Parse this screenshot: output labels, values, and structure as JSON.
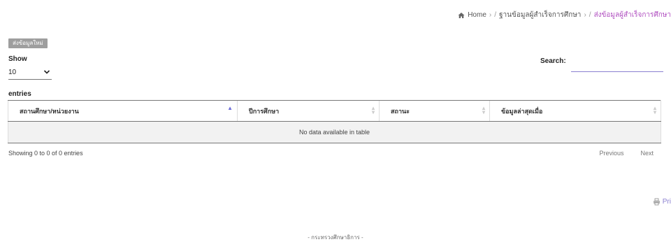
{
  "breadcrumb": {
    "home": "Home",
    "separator": "›",
    "slash": "/",
    "level1": "ฐานข้อมูลผู้สำเร็จการศึกษา",
    "current": "ส่งข้อมูลผู้สำเร็จการศึกษา"
  },
  "actions": {
    "add_label": "ส่งข้อมูลใหม่"
  },
  "length": {
    "show_label": "Show",
    "selected": "10",
    "entries_label": "entries"
  },
  "search": {
    "label": "Search:",
    "value": ""
  },
  "table": {
    "columns": [
      "สถานศึกษา/หน่วยงาน",
      "ปีการศึกษา",
      "สถานะ",
      "ข้อมูลล่าสุดเมื่อ"
    ],
    "empty_message": "No data available in table"
  },
  "info": "Showing 0 to 0 of 0 entries",
  "pagination": {
    "previous": "Previous",
    "next": "Next"
  },
  "print_label": "Pri",
  "footer": "- กระทรวงศึกษาธิการ -",
  "colors": {
    "accent": "#b04fc0",
    "button_bg": "#9e9e9e",
    "search_underline": "#8a7fd0"
  }
}
